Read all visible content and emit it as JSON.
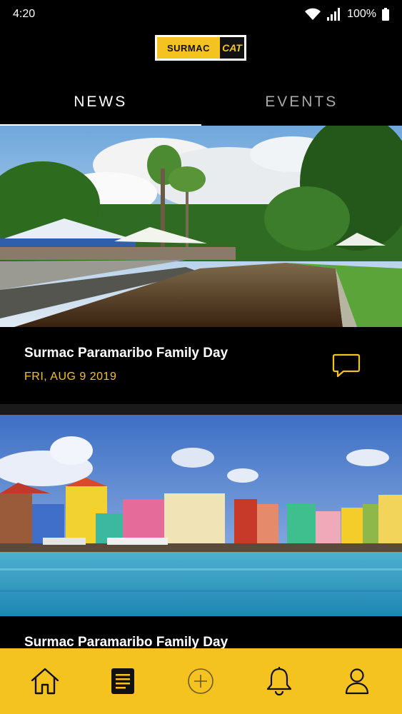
{
  "status": {
    "time": "4:20",
    "battery": "100%"
  },
  "logo": {
    "left": "SURMAC",
    "right": "CAT"
  },
  "tabs": [
    {
      "label": "NEWS",
      "active": true
    },
    {
      "label": "EVENTS",
      "active": false
    }
  ],
  "cards": [
    {
      "title": "Surmac Paramaribo Family Day",
      "date": "FRI, AUG 9 2019",
      "image": "park-canal-photo"
    },
    {
      "title": "Surmac Paramaribo Family Day",
      "image": "colorful-waterfront-photo"
    }
  ],
  "nav": [
    {
      "icon": "home-icon"
    },
    {
      "icon": "news-icon",
      "active": true
    },
    {
      "icon": "add-icon"
    },
    {
      "icon": "bell-icon"
    },
    {
      "icon": "profile-icon"
    }
  ],
  "colors": {
    "accent": "#f5c320",
    "background": "#000000"
  }
}
